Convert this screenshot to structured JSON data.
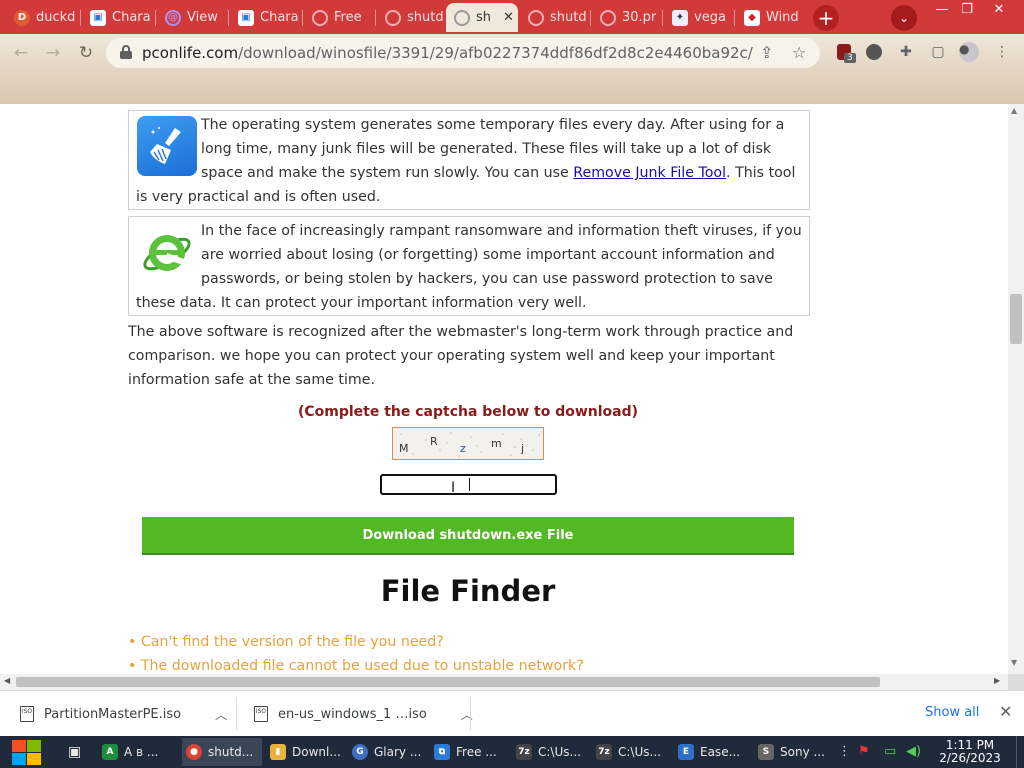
{
  "tabs": [
    {
      "label": "duckd",
      "icon": "duckduckgo-icon",
      "color": "#de5833"
    },
    {
      "label": "Chara",
      "icon": "site-icon",
      "color": "#2b7bd6"
    },
    {
      "label": "View",
      "icon": "view-icon",
      "color": "#8a5cd1"
    },
    {
      "label": "Chara",
      "icon": "site-icon",
      "color": "#2b7bd6"
    },
    {
      "label": "Free",
      "icon": "globe-icon",
      "color": "#d66"
    },
    {
      "label": "shutd",
      "icon": "globe-icon",
      "color": "#d66"
    },
    {
      "label": "sh",
      "icon": "globe-icon",
      "color": "#999"
    },
    {
      "label": "shutd",
      "icon": "globe-icon",
      "color": "#d66"
    },
    {
      "label": "30.pr",
      "icon": "globe-icon",
      "color": "#d66"
    },
    {
      "label": "vega",
      "icon": "vegas-icon",
      "color": "#335"
    },
    {
      "label": "Wind",
      "icon": "windows-icon",
      "color": "#c22"
    }
  ],
  "address": {
    "domain": "pconlife.com",
    "path": "/download/winosfile/3391/29/afb0227374ddf86df2d8c2e4460ba92c/"
  },
  "extensions": {
    "ublock_count": "3"
  },
  "content": {
    "card1": {
      "text_before": "The operating system generates some temporary files every day. After using for a long time, many junk files will be generated. These files will take up a lot of disk space and make the system run slowly. You can use ",
      "link": "Remove Junk File Tool",
      "text_after": ". This tool is very practical and is often used."
    },
    "card2": {
      "text": "In the face of increasingly rampant ransomware and information theft viruses, if you are worried about losing (or forgetting) some important account information and passwords, or being stolen by hackers, you can use password protection to save these data. It can protect your important information very well."
    },
    "summary": "The above software is recognized after the webmaster's long-term work through practice and comparison. we hope you can protect your operating system well and keep your important information safe at the same time.",
    "captcha_label": "(Complete the captcha below to download)",
    "captcha_chars": [
      "M",
      "R",
      "z",
      "m",
      "j"
    ],
    "captcha_input_value": "",
    "download_button": "Download shutdown.exe File",
    "section_title": "File Finder",
    "faq": [
      "• Can't find the version of the file you need?",
      "• The downloaded file cannot be used due to unstable network?"
    ]
  },
  "downloads": [
    {
      "name": "PartitionMasterPE.iso"
    },
    {
      "name": "en-us_windows_1 …iso"
    }
  ],
  "shelf": {
    "show_all": "Show all"
  },
  "taskbar": {
    "items": [
      {
        "label": "A в ...",
        "color": "#1e8e3e",
        "glyph": "A"
      },
      {
        "label": "shutd...",
        "color": "#db4437",
        "glyph": "●"
      },
      {
        "label": "Downl...",
        "color": "#e8b33a",
        "glyph": "▮"
      },
      {
        "label": "Glary ...",
        "color": "#3d6fc4",
        "glyph": "G"
      },
      {
        "label": "Free ...",
        "color": "#2b7bd6",
        "glyph": "⧉"
      },
      {
        "label": "C:\\Us...",
        "color": "#444",
        "glyph": "7z"
      },
      {
        "label": "C:\\Us...",
        "color": "#444",
        "glyph": "7z"
      },
      {
        "label": "Ease...",
        "color": "#2e6fc9",
        "glyph": "E"
      },
      {
        "label": "Sony ...",
        "color": "#666",
        "glyph": "S"
      }
    ],
    "time": "1:11 PM",
    "date": "2/26/2023"
  }
}
